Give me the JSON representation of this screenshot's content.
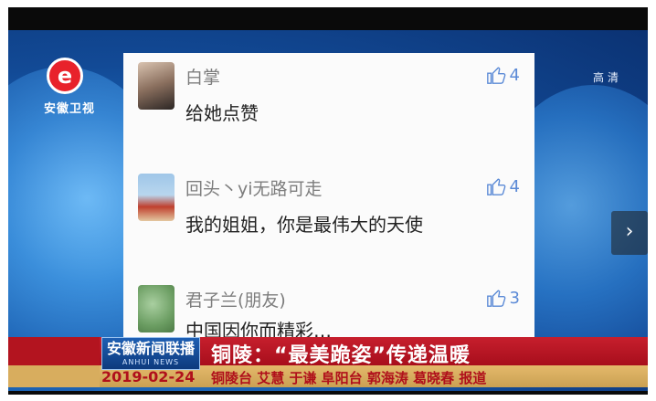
{
  "channel": {
    "logo_text": "安徽卫视",
    "quality_label": "高清"
  },
  "comments": [
    {
      "username": "白掌",
      "text": "给她点赞",
      "likes": "4"
    },
    {
      "username": "回头丶yi无路可走",
      "text": "我的姐姐，你是最伟大的天使",
      "likes": "4"
    },
    {
      "username": "君子兰(朋友)",
      "text": "中国因你而精彩…",
      "likes": "3"
    }
  ],
  "ticker": {
    "program_name": "安徽新闻联播",
    "program_sub": "ANHUI NEWS",
    "headline": "铜陵：“最美跪姿”传递温暖",
    "date": "2019-02-24",
    "credits": "铜陵台 艾慧 于谦 阜阳台 郭海涛 葛晓春 报道"
  },
  "colors": {
    "ticker_red": "#b3141f",
    "ticker_gold": "#d8ad5e",
    "like_blue": "#5b8ad6"
  }
}
